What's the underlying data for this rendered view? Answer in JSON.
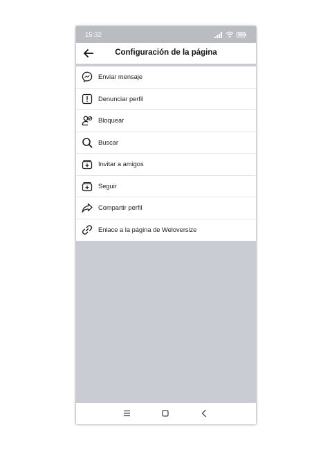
{
  "status_bar": {
    "time": "15:32"
  },
  "header": {
    "title": "Configuración de la página",
    "back_icon": "back-arrow-icon"
  },
  "menu": {
    "items": [
      {
        "label": "Enviar mensaje",
        "icon": "messenger-icon"
      },
      {
        "label": "Denunciar perfil",
        "icon": "report-icon"
      },
      {
        "label": "Bloquear",
        "icon": "block-user-icon"
      },
      {
        "label": "Buscar",
        "icon": "search-icon"
      },
      {
        "label": "Invitar a amigos",
        "icon": "invite-icon"
      },
      {
        "label": "Seguir",
        "icon": "follow-icon"
      },
      {
        "label": "Compartir perfil",
        "icon": "share-icon"
      },
      {
        "label": "Enlace a la página de Weloversize",
        "icon": "link-icon"
      }
    ]
  },
  "nav_bar": {
    "icons": [
      "nav-menu-icon",
      "nav-home-icon",
      "nav-back-icon"
    ]
  },
  "colors": {
    "background_gray": "#c9cdd3",
    "status_bar": "#b9bcc1",
    "text": "#1c1c1c"
  }
}
